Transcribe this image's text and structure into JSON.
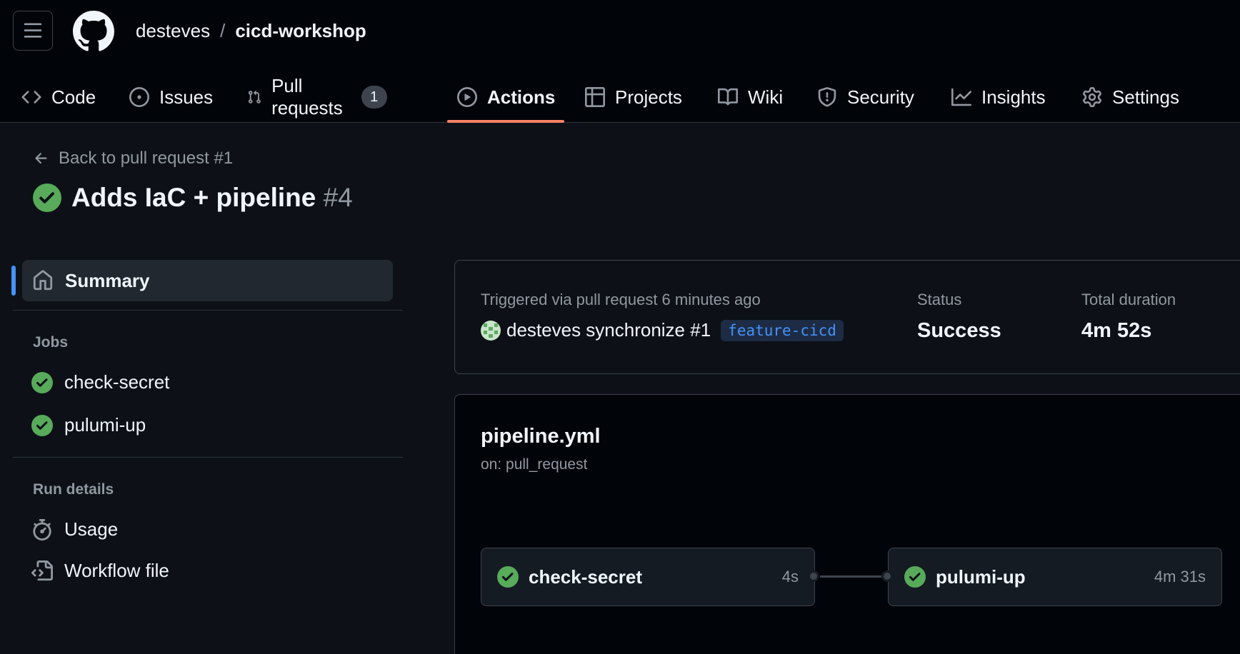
{
  "header": {
    "owner": "desteves",
    "separator": "/",
    "repo": "cicd-workshop"
  },
  "nav": {
    "tabs": [
      {
        "label": "Code",
        "icon": "code-icon"
      },
      {
        "label": "Issues",
        "icon": "issue-opened-icon"
      },
      {
        "label": "Pull requests",
        "icon": "git-pull-request-icon",
        "count": "1"
      },
      {
        "label": "Actions",
        "icon": "play-icon",
        "active": true
      },
      {
        "label": "Projects",
        "icon": "table-icon"
      },
      {
        "label": "Wiki",
        "icon": "book-icon"
      },
      {
        "label": "Security",
        "icon": "shield-icon"
      },
      {
        "label": "Insights",
        "icon": "graph-icon"
      },
      {
        "label": "Settings",
        "icon": "gear-icon"
      }
    ]
  },
  "run": {
    "back_link": "Back to pull request #1",
    "title": "Adds IaC + pipeline",
    "number": "#4"
  },
  "sidebar": {
    "summary": "Summary",
    "jobs_heading": "Jobs",
    "jobs": [
      "check-secret",
      "pulumi-up"
    ],
    "run_details_heading": "Run details",
    "usage": "Usage",
    "workflow_file": "Workflow file"
  },
  "summary": {
    "triggered": "Triggered via pull request 6 minutes ago",
    "actor_line": "desteves synchronize #1",
    "branch": "feature-cicd",
    "status_label": "Status",
    "status_value": "Success",
    "duration_label": "Total duration",
    "duration_value": "4m 52s"
  },
  "workflow": {
    "name": "pipeline.yml",
    "on": "on: pull_request",
    "jobs": [
      {
        "name": "check-secret",
        "duration": "4s"
      },
      {
        "name": "pulumi-up",
        "duration": "4m 31s"
      }
    ]
  },
  "colors": {
    "success": "#57ab5a",
    "accent_underline": "#f78166",
    "link": "#4493f8"
  }
}
